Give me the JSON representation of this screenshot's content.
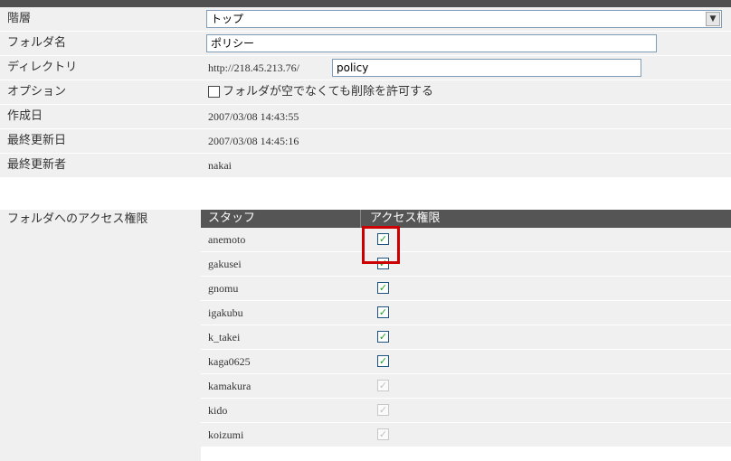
{
  "form": {
    "hierarchy": {
      "label": "階層",
      "selected": "トップ"
    },
    "folder_name": {
      "label": "フォルダ名",
      "value": "ポリシー"
    },
    "directory": {
      "label": "ディレクトリ",
      "prefix": "http://218.45.213.76/",
      "value": "policy"
    },
    "option": {
      "label": "オプション",
      "checkbox_label": "フォルダが空でなくても削除を許可する",
      "checked": false
    },
    "created": {
      "label": "作成日",
      "value": "2007/03/08 14:43:55"
    },
    "updated": {
      "label": "最終更新日",
      "value": "2007/03/08 14:45:16"
    },
    "updated_by": {
      "label": "最終更新者",
      "value": "nakai"
    }
  },
  "access": {
    "label": "フォルダへのアクセス権限",
    "header_staff": "スタッフ",
    "header_permission": "アクセス権限",
    "rows": [
      {
        "name": "anemoto",
        "checked": true,
        "enabled": true
      },
      {
        "name": "gakusei",
        "checked": true,
        "enabled": true
      },
      {
        "name": "gnomu",
        "checked": true,
        "enabled": true
      },
      {
        "name": "igakubu",
        "checked": true,
        "enabled": true
      },
      {
        "name": "k_takei",
        "checked": true,
        "enabled": true
      },
      {
        "name": "kaga0625",
        "checked": true,
        "enabled": true
      },
      {
        "name": "kamakura",
        "checked": true,
        "enabled": false
      },
      {
        "name": "kido",
        "checked": true,
        "enabled": false
      },
      {
        "name": "koizumi",
        "checked": true,
        "enabled": false
      }
    ]
  },
  "colors": {
    "header_bg": "#555555",
    "row_bg": "#f0f0f0",
    "highlight": "#cc0000",
    "check": "#21a121"
  }
}
